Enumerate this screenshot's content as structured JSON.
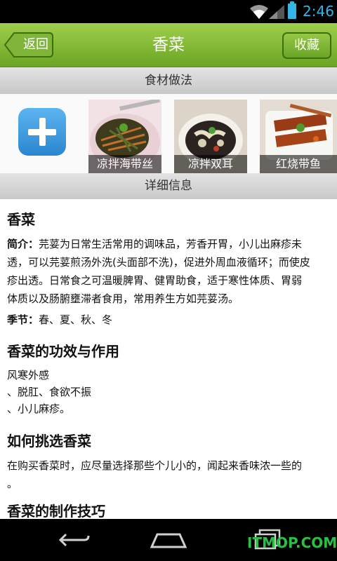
{
  "status_bar": {
    "time": "2:46",
    "accent": "#33b5e5"
  },
  "header": {
    "back_label": "返回",
    "title": "香菜",
    "favorite_label": "收藏",
    "brand_color": "#7cb82f"
  },
  "recipes_section": {
    "title": "食材做法",
    "add_icon": "plus-icon",
    "dishes": [
      {
        "name": "凉拌海带丝"
      },
      {
        "name": "凉拌双耳"
      },
      {
        "name": "红烧带鱼"
      }
    ]
  },
  "details_section": {
    "title": "详细信息",
    "ingredient_name": "香菜",
    "intro_label": "简介：",
    "intro_line1": "芫荽为日常生活常用的调味品，芳香开胃，小儿出麻疹未",
    "intro_line2": "透，可以芫荽煎汤外洗(头面部不洗)，促进外周血液循环；而使皮",
    "intro_line3": "疹出透。日常食之可温暖脾胃、健胃助食，适于寒性体质、胃弱",
    "intro_line4": "体质以及肠腑壅滞者食用，常用养生方如芫荽汤。",
    "season_label": "季节：",
    "season_value": "春、夏、秋、冬",
    "effects_title": "香菜的功效与作用",
    "effects_line1": "风寒外感",
    "effects_line2": "、脱肛、食欲不振",
    "effects_line3": "、小儿麻疹。",
    "choose_title": "如何挑选香菜",
    "choose_line1": "在购买香菜时，应尽量选择那些个儿小的，闻起来香味浓一些的",
    "choose_line2": "。",
    "tips_title": "香菜的制作技巧"
  },
  "watermark": "ITMOP.COM"
}
